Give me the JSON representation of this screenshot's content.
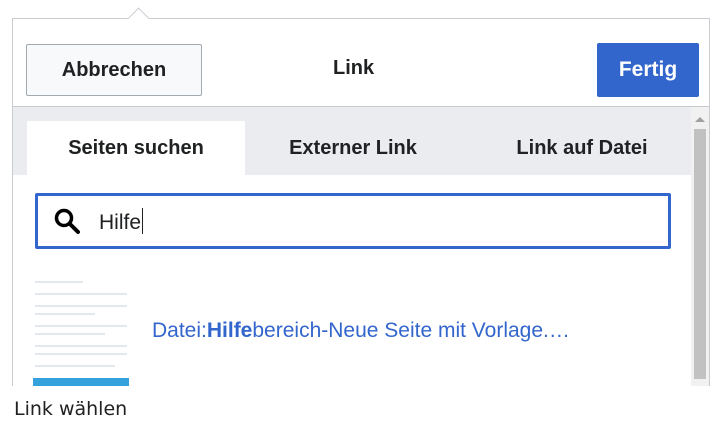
{
  "dialog": {
    "title": "Link",
    "cancel_label": "Abbrechen",
    "done_label": "Fertig",
    "accent_color": "#3366cc"
  },
  "tabs": [
    {
      "label": "Seiten suchen",
      "active": true
    },
    {
      "label": "Externer Link",
      "active": false
    },
    {
      "label": "Link auf Datei",
      "active": false
    }
  ],
  "search": {
    "value": "Hilfe",
    "icon": "search-icon"
  },
  "results": [
    {
      "prefix": "Datei:",
      "match": "Hilfe",
      "rest": "bereich-Neue Seite mit Vorlage.…"
    }
  ],
  "caption": "Link wählen"
}
